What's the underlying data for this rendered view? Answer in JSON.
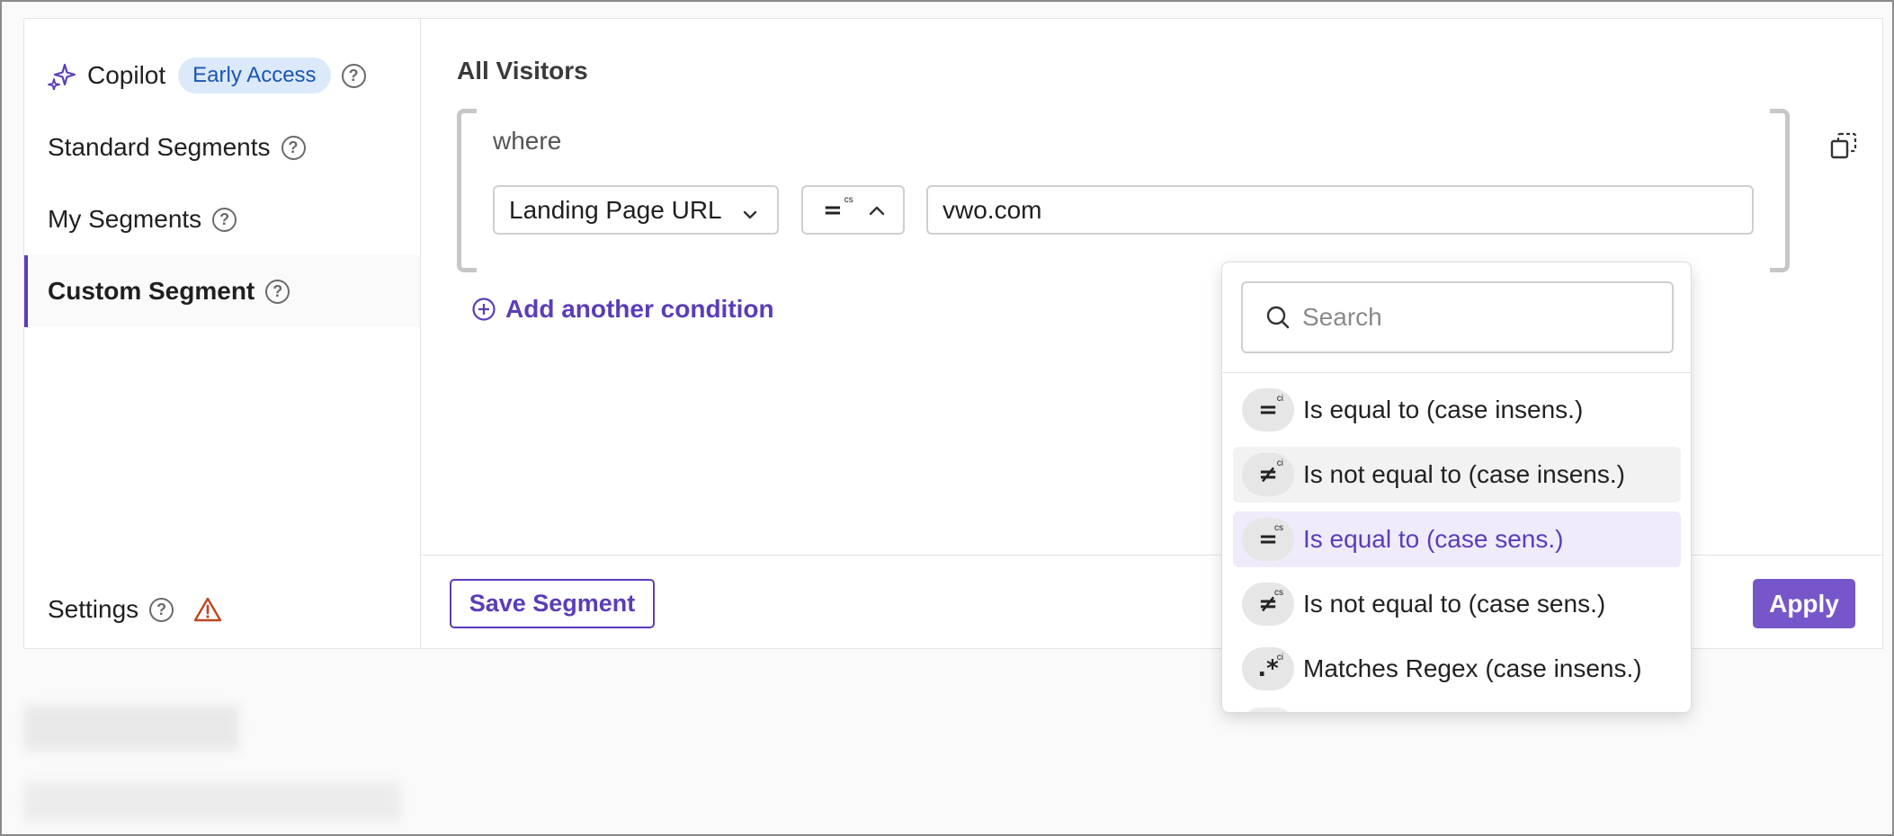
{
  "sidebar": {
    "copilot_label": "Copilot",
    "copilot_badge": "Early Access",
    "items": [
      {
        "label": "Standard Segments"
      },
      {
        "label": "My Segments"
      },
      {
        "label": "Custom Segment",
        "active": true
      }
    ],
    "settings_label": "Settings",
    "help_glyph": "?"
  },
  "main": {
    "title": "All Visitors",
    "where_label": "where",
    "condition": {
      "field": "Landing Page URL",
      "operator_symbol": "=",
      "operator_sup": "cs",
      "value": "vwo.com"
    },
    "add_condition_label": "Add another condition",
    "save_label": "Save Segment",
    "apply_label": "Apply"
  },
  "dropdown": {
    "search_placeholder": "Search",
    "options": [
      {
        "symbol": "=",
        "sup": "ci",
        "label": "Is equal to (case insens.)"
      },
      {
        "symbol": "≠",
        "sup": "ci",
        "label": "Is not equal to (case insens.)",
        "hovered": true
      },
      {
        "symbol": "=",
        "sup": "cs",
        "label": "Is equal to (case sens.)",
        "selected": true
      },
      {
        "symbol": "≠",
        "sup": "cs",
        "label": "Is not equal to (case sens.)"
      },
      {
        "symbol": ".*",
        "sup": "ci",
        "label": "Matches Regex (case insens.)"
      }
    ]
  },
  "colors": {
    "accent": "#5b3db8",
    "apply_bg": "#7656c9",
    "badge_bg": "#dce9fb",
    "badge_text": "#1a56b3",
    "warning": "#c0451e",
    "selected_bg": "#efebfa"
  },
  "icons": [
    "sparkle-icon",
    "help-icon",
    "warning-icon",
    "chevron-down-icon",
    "chevron-up-icon",
    "copy-icon",
    "plus-circle-icon",
    "search-icon"
  ]
}
